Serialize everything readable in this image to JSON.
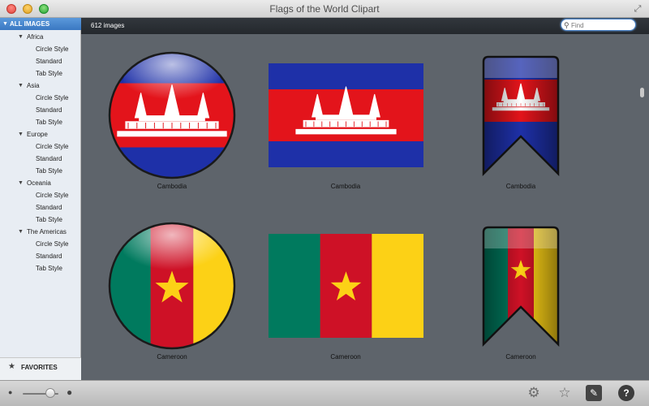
{
  "window": {
    "title": "Flags of the World Clipart"
  },
  "sidebar": {
    "all_images": "ALL IMAGES",
    "regions": [
      {
        "name": "Africa",
        "items": [
          "Circle Style",
          "Standard",
          "Tab Style"
        ]
      },
      {
        "name": "Asia",
        "items": [
          "Circle Style",
          "Standard",
          "Tab Style"
        ]
      },
      {
        "name": "Europe",
        "items": [
          "Circle Style",
          "Standard",
          "Tab Style"
        ]
      },
      {
        "name": "Oceania",
        "items": [
          "Circle Style",
          "Standard",
          "Tab Style"
        ]
      },
      {
        "name": "The Americas",
        "items": [
          "Circle Style",
          "Standard",
          "Tab Style"
        ]
      }
    ],
    "favorites": "FAVORITES"
  },
  "content": {
    "count": "612 images",
    "search_placeholder": "Find",
    "flags": [
      {
        "country": "Cambodia",
        "style": "circle"
      },
      {
        "country": "Cambodia",
        "style": "standard"
      },
      {
        "country": "Cambodia",
        "style": "tab"
      },
      {
        "country": "Cameroon",
        "style": "circle"
      },
      {
        "country": "Cameroon",
        "style": "standard"
      },
      {
        "country": "Cameroon",
        "style": "tab"
      }
    ]
  },
  "colors": {
    "cambodia_blue": "#1e30a8",
    "cambodia_red": "#e3141b",
    "cameroon_green": "#007a5e",
    "cameroon_red": "#ce1126",
    "cameroon_yellow": "#fcd116",
    "selection": "#3a78c2"
  },
  "icons": {
    "zoom_min": "person-small-icon",
    "zoom_max": "person-large-icon",
    "tools": [
      "gear-icon",
      "star-outline-icon",
      "wrench-icon",
      "help-icon"
    ]
  }
}
